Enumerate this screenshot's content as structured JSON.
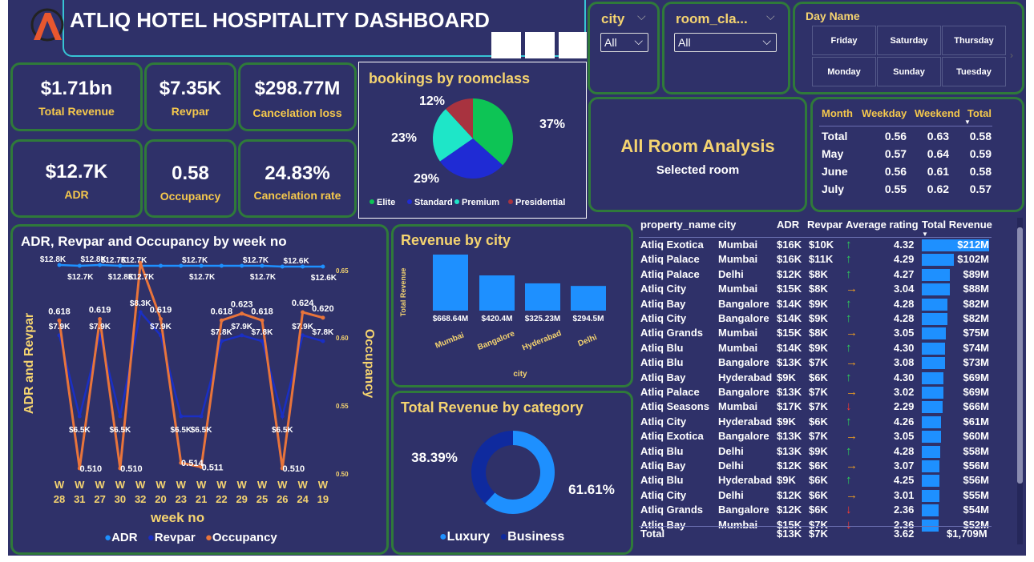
{
  "header": {
    "title": "ATLIQ HOTEL HOSPITALITY DASHBOARD",
    "logo_letter": "A"
  },
  "filters": {
    "city": {
      "label": "city",
      "value": "All"
    },
    "room_class": {
      "label": "room_cla...",
      "value": "All"
    },
    "day_name": {
      "label": "Day Name",
      "days": [
        "Friday",
        "Saturday",
        "Thursday",
        "Monday",
        "Sunday",
        "Tuesday"
      ]
    }
  },
  "kpis": [
    {
      "value": "$1.71bn",
      "label": "Total Revenue"
    },
    {
      "value": "$7.35K",
      "label": "Revpar"
    },
    {
      "value": "$298.77M",
      "label": "Cancelation loss"
    },
    {
      "value": "$12.7K",
      "label": "ADR"
    },
    {
      "value": "0.58",
      "label": "Occupancy"
    },
    {
      "value": "24.83%",
      "label": "Cancelation rate"
    }
  ],
  "pie": {
    "title": "bookings by roomclass",
    "legend": [
      "Elite",
      "Standard",
      "Premium",
      "Presidential"
    ],
    "colors": [
      "#0dc455",
      "#1f2bd4",
      "#1ee6c8",
      "#a8333f"
    ],
    "labels": [
      "37%",
      "29%",
      "23%",
      "12%"
    ]
  },
  "room_analysis": {
    "title": "All Room Analysis",
    "subtitle": "Selected room"
  },
  "matrix": {
    "headers": [
      "Month",
      "Weekday",
      "Weekend",
      "Total"
    ],
    "rows": [
      [
        "Total",
        "0.56",
        "0.63",
        "0.58"
      ],
      [
        "May",
        "0.57",
        "0.64",
        "0.59"
      ],
      [
        "June",
        "0.56",
        "0.61",
        "0.58"
      ],
      [
        "July",
        "0.55",
        "0.62",
        "0.57"
      ]
    ]
  },
  "line_chart": {
    "title": "ADR, Revpar and Occupancy by week no",
    "xlabel": "week no",
    "ylabel_left": "ADR and Revpar",
    "ylabel_right": "Occupancy",
    "legend": [
      "ADR",
      "Revpar",
      "Occupancy"
    ]
  },
  "city_chart": {
    "title": "Revenue by city",
    "xlabel": "city",
    "ylabel": "Total Revenue"
  },
  "donut": {
    "title": "Total Revenue by category",
    "legend": [
      "Luxury",
      "Business"
    ],
    "labels": [
      "61.61%",
      "38.39%"
    ],
    "colors": [
      "#1e90ff",
      "#0f2a9e"
    ]
  },
  "table": {
    "headers": [
      "property_name",
      "city",
      "ADR",
      "Revpar",
      "Average rating",
      "Total Revenue"
    ],
    "rows": [
      [
        "Atliq Exotica",
        "Mumbai",
        "$16K",
        "$10K",
        "up",
        "4.32",
        "$212M"
      ],
      [
        "Atliq Palace",
        "Mumbai",
        "$16K",
        "$11K",
        "up",
        "4.29",
        "$102M"
      ],
      [
        "Atliq Palace",
        "Delhi",
        "$12K",
        "$8K",
        "up",
        "4.27",
        "$89M"
      ],
      [
        "Atliq City",
        "Mumbai",
        "$15K",
        "$8K",
        "right",
        "3.04",
        "$88M"
      ],
      [
        "Atliq Bay",
        "Bangalore",
        "$14K",
        "$9K",
        "up",
        "4.28",
        "$82M"
      ],
      [
        "Atliq City",
        "Bangalore",
        "$14K",
        "$9K",
        "up",
        "4.28",
        "$82M"
      ],
      [
        "Atliq Grands",
        "Mumbai",
        "$15K",
        "$8K",
        "right",
        "3.05",
        "$75M"
      ],
      [
        "Atliq Blu",
        "Mumbai",
        "$14K",
        "$9K",
        "up",
        "4.30",
        "$74M"
      ],
      [
        "Atliq Blu",
        "Bangalore",
        "$13K",
        "$7K",
        "right",
        "3.08",
        "$73M"
      ],
      [
        "Atliq Bay",
        "Hyderabad",
        "$9K",
        "$6K",
        "up",
        "4.30",
        "$69M"
      ],
      [
        "Atliq Palace",
        "Bangalore",
        "$13K",
        "$7K",
        "right",
        "3.02",
        "$69M"
      ],
      [
        "Atliq Seasons",
        "Mumbai",
        "$17K",
        "$7K",
        "down",
        "2.29",
        "$66M"
      ],
      [
        "Atliq City",
        "Hyderabad",
        "$9K",
        "$6K",
        "up",
        "4.26",
        "$61M"
      ],
      [
        "Atliq Exotica",
        "Bangalore",
        "$13K",
        "$7K",
        "right",
        "3.05",
        "$60M"
      ],
      [
        "Atliq Blu",
        "Delhi",
        "$13K",
        "$9K",
        "up",
        "4.28",
        "$58M"
      ],
      [
        "Atliq Bay",
        "Delhi",
        "$12K",
        "$6K",
        "right",
        "3.07",
        "$56M"
      ],
      [
        "Atliq Blu",
        "Hyderabad",
        "$9K",
        "$6K",
        "up",
        "4.25",
        "$56M"
      ],
      [
        "Atliq City",
        "Delhi",
        "$12K",
        "$6K",
        "right",
        "3.01",
        "$55M"
      ],
      [
        "Atliq Grands",
        "Bangalore",
        "$12K",
        "$6K",
        "down",
        "2.36",
        "$54M"
      ],
      [
        "Atliq Bay",
        "Mumbai",
        "$15K",
        "$7K",
        "down",
        "2.36",
        "$52M"
      ]
    ],
    "total": [
      "Total",
      "",
      "$13K",
      "$7K",
      "",
      "3.62",
      "$1,709M"
    ]
  },
  "chart_data": [
    {
      "type": "pie",
      "title": "bookings by roomclass",
      "categories": [
        "Elite",
        "Standard",
        "Premium",
        "Presidential"
      ],
      "values": [
        37,
        29,
        23,
        12
      ]
    },
    {
      "type": "bar",
      "title": "Revenue by city",
      "xlabel": "city",
      "ylabel": "Total Revenue",
      "categories": [
        "Mumbai",
        "Bangalore",
        "Hyderabad",
        "Delhi"
      ],
      "values": [
        668.64,
        420.4,
        325.23,
        294.5
      ],
      "value_labels": [
        "$668.64M",
        "$420.4M",
        "$325.23M",
        "$294.5M"
      ]
    },
    {
      "type": "pie",
      "title": "Total Revenue by category",
      "categories": [
        "Luxury",
        "Business"
      ],
      "values": [
        61.61,
        38.39
      ]
    },
    {
      "type": "line",
      "title": "ADR, Revpar and Occupancy by week no",
      "xlabel": "week no",
      "ylabel": "ADR and Revpar",
      "y2label": "Occupancy",
      "categories": [
        "W 28",
        "W 31",
        "W 27",
        "W 30",
        "W 32",
        "W 20",
        "W 23",
        "W 21",
        "W 22",
        "W 29",
        "W 25",
        "W 26",
        "W 24",
        "W 19"
      ],
      "series": [
        {
          "name": "ADR",
          "values": [
            12.8,
            12.7,
            12.8,
            12.7,
            12.7,
            12.7,
            12.7,
            12.7,
            12.7,
            12.7,
            12.7,
            12.6,
            12.6,
            12.6
          ],
          "labels": [
            "$12.8K",
            "",
            "$12.8K",
            "$12.7K",
            "$12.7K",
            "",
            "",
            "$12.7K",
            "",
            "",
            "$12.7K",
            "",
            "$12.6K",
            ""
          ]
        },
        {
          "name": "Revpar",
          "values": [
            7.9,
            6.5,
            7.9,
            6.5,
            8.3,
            7.9,
            6.5,
            6.5,
            7.8,
            7.9,
            7.8,
            6.5,
            7.9,
            7.8
          ],
          "labels": [
            "$7.9K",
            "$6.5K",
            "$7.9K",
            "$6.5K",
            "$8.3K",
            "$7.9K",
            "$6.5K",
            "$6.5K",
            "$7.8K",
            "$7.9K",
            "$7.8K",
            "$6.5K",
            "$7.9K",
            "$7.8K"
          ]
        },
        {
          "name": "Occupancy",
          "values": [
            0.618,
            0.51,
            0.619,
            0.51,
            0.66,
            0.619,
            0.514,
            0.511,
            0.618,
            0.623,
            0.618,
            0.51,
            0.624,
            0.62
          ],
          "labels": [
            "0.618",
            "0.510",
            "0.619",
            "0.510",
            "",
            "0.619",
            "0.514",
            "0.511",
            "0.618",
            "0.623",
            "0.618",
            "0.510",
            "0.624",
            "0.620"
          ]
        }
      ],
      "adr_extra_labels": [
        "$12.7K",
        "$12.8K",
        "$12.7K",
        "$12.7K",
        "$12.7K",
        "$12.6K"
      ],
      "y2ticks": [
        "0.65",
        "0.60",
        "0.55",
        "0.50"
      ]
    }
  ]
}
